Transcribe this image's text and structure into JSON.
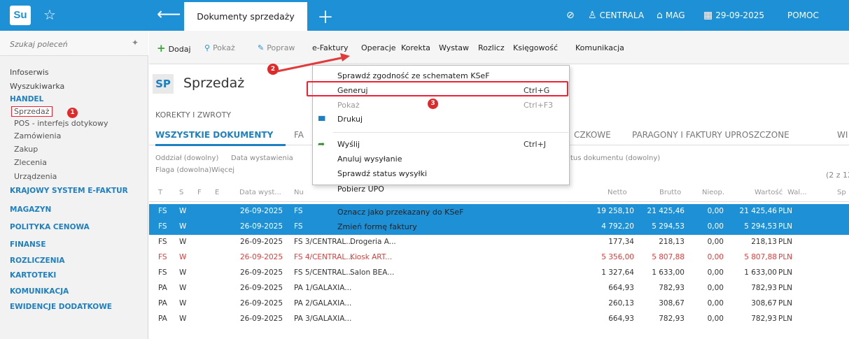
{
  "titlebar": {
    "tab": "Dokumenty sprzedaży",
    "centrala": "CENTRALA",
    "mag": "MAG",
    "date": "29-09-2025",
    "pomoc": "POMOC"
  },
  "sidebar": {
    "search_placeholder": "Szukaj poleceń",
    "items": [
      "Infoserwis",
      "Wyszukiwarka",
      "HANDEL",
      "Sprzedaż",
      "POS - interfejs dotykowy",
      "Zamówienia",
      "Zakup",
      "Zlecenia",
      "Urządzenia",
      "KRAJOWY SYSTEM E-FAKTUR",
      "MAGAZYN",
      "POLITYKA CENOWA",
      "FINANSE",
      "ROZLICZENIA",
      "KARTOTEKI",
      "KOMUNIKACJA",
      "EWIDENCJE DODATKOWE"
    ],
    "badge1": "1"
  },
  "toolbar": {
    "dodaj": "Dodaj",
    "pokaz": "Pokaż",
    "popraw": "Popraw",
    "efaktury": "e-Faktury",
    "operacje": "Operacje",
    "korekta": "Korekta",
    "wystaw": "Wystaw",
    "rozlicz": "Rozlicz",
    "ksiegowosc": "Księgowość",
    "komunikacja": "Komunikacja"
  },
  "header": {
    "badge": "SP",
    "title": "Sprzedaż",
    "korekty": "KOREKTY I ZWROTY",
    "tab_all": "WSZYSTKIE DOKUMENTY",
    "tab_fa": "FA",
    "tab_czkowe": "CZKOWE",
    "tab_paragony": "PARAGONY I FAKTURY UPROSZCZONE",
    "tab_wi": "WI",
    "filter_oddzial": "Oddział (dowolny)",
    "filter_data": "Data wystawienia",
    "filter_flaga": "Flaga (dowolna)",
    "filter_wiecej": "Więcej",
    "filter_status": "tus dokumentu (dowolny)",
    "count": "(2 z 12"
  },
  "table": {
    "headers": {
      "t": "T",
      "s": "S",
      "f": "F",
      "e": "E",
      "data": "Data wyst...",
      "nu": "Nu",
      "netto": "Netto",
      "brutto": "Brutto",
      "nieop": "Nieop.",
      "wartosc": "Wartość",
      "wal": "Wal...",
      "sp": "Sp"
    },
    "rows": [
      {
        "t": "FS",
        "s": "W",
        "data": "26-09-2025",
        "nr": "FS",
        "kontr": "",
        "netto": "19 258,10",
        "brutto": "21 425,46",
        "nieop": "0,00",
        "wartosc": "21 425,46",
        "wal": "PLN"
      },
      {
        "t": "FS",
        "s": "W",
        "data": "26-09-2025",
        "nr": "FS",
        "kontr": "",
        "netto": "4 792,20",
        "brutto": "5 294,53",
        "nieop": "0,00",
        "wartosc": "5 294,53",
        "wal": "PLN"
      },
      {
        "t": "FS",
        "s": "W",
        "data": "26-09-2025",
        "nr": "FS 3/CENTRAL...",
        "kontr": "Drogeria A...",
        "netto": "177,34",
        "brutto": "218,13",
        "nieop": "0,00",
        "wartosc": "218,13",
        "wal": "PLN"
      },
      {
        "t": "FS",
        "s": "W",
        "data": "26-09-2025",
        "nr": "FS 4/CENTRAL...",
        "kontr": "Kiosk ART...",
        "netto": "5 356,00",
        "brutto": "5 807,88",
        "nieop": "0,00",
        "wartosc": "5 807,88",
        "wal": "PLN"
      },
      {
        "t": "FS",
        "s": "W",
        "data": "26-09-2025",
        "nr": "FS 5/CENTRAL...",
        "kontr": "Salon BEA...",
        "netto": "1 327,64",
        "brutto": "1 633,00",
        "nieop": "0,00",
        "wartosc": "1 633,00",
        "wal": "PLN"
      },
      {
        "t": "PA",
        "s": "W",
        "data": "26-09-2025",
        "nr": "PA 1/GALAXIA...",
        "kontr": "",
        "netto": "664,93",
        "brutto": "782,93",
        "nieop": "0,00",
        "wartosc": "782,93",
        "wal": "PLN"
      },
      {
        "t": "PA",
        "s": "W",
        "data": "26-09-2025",
        "nr": "PA 2/GALAXIA...",
        "kontr": "",
        "netto": "260,13",
        "brutto": "308,67",
        "nieop": "0,00",
        "wartosc": "308,67",
        "wal": "PLN"
      },
      {
        "t": "PA",
        "s": "W",
        "data": "26-09-2025",
        "nr": "PA 3/GALAXIA...",
        "kontr": "",
        "netto": "664,93",
        "brutto": "782,93",
        "nieop": "0,00",
        "wartosc": "782,93",
        "wal": "PLN"
      }
    ]
  },
  "dropdown": {
    "items": [
      {
        "label": "Sprawdź zgodność ze schematem KSeF",
        "shortcut": ""
      },
      {
        "label": "Generuj",
        "shortcut": "Ctrl+G"
      },
      {
        "label": "Pokaż",
        "shortcut": "Ctrl+F3"
      },
      {
        "label": "Drukuj",
        "shortcut": ""
      },
      {
        "label": "Wyślij",
        "shortcut": "Ctrl+J"
      },
      {
        "label": "Anuluj wysyłanie",
        "shortcut": ""
      },
      {
        "label": "Sprawdź status wysyłki",
        "shortcut": ""
      },
      {
        "label": "Pobierz UPO",
        "shortcut": ""
      },
      {
        "label": "Oznacz jako przekazany do KSeF",
        "shortcut": ""
      },
      {
        "label": "Zmień formę faktury",
        "shortcut": ""
      }
    ],
    "badge2": "2",
    "badge3": "3"
  },
  "colors": {
    "accent": "#1e90d6",
    "section": "#1e7fc2",
    "highlight": "#e23b3b"
  }
}
